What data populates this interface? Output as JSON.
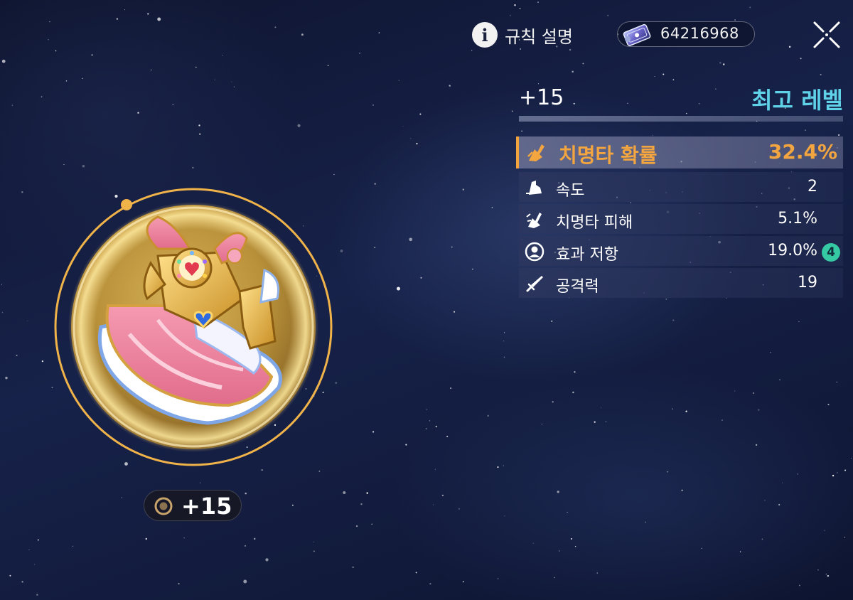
{
  "header": {
    "rules_label": "규칙 설명",
    "rules_icon": "info-icon",
    "currency_icon": "ticket-card-icon",
    "currency_value": "64216968",
    "close_icon": "close-x-icon"
  },
  "level": {
    "current": "+15",
    "status": "최고 레벨",
    "status_color": "#5fd2e8"
  },
  "main_stat": {
    "icon": "critical-rate-icon",
    "name": "치명타 확률",
    "value": "32.4%",
    "color": "#f3a53f"
  },
  "sub_stats": [
    {
      "icon": "speed-icon",
      "name": "속도",
      "value": "2"
    },
    {
      "icon": "critical-damage-icon",
      "name": "치명타 피해",
      "value": "5.1%"
    },
    {
      "icon": "effect-resistance-icon",
      "name": "효과 저항",
      "value": "19.0%",
      "badge": "4"
    },
    {
      "icon": "attack-sword-icon",
      "name": "공격력",
      "value": "19"
    }
  ],
  "equipment": {
    "icon": "pink-dress-armor-icon",
    "enhance_icon": "enhance-ring-icon",
    "enhance_level": "+15",
    "frame_color": "#f0b34a"
  }
}
